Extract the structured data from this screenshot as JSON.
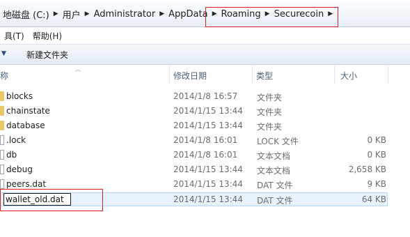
{
  "breadcrumb": [
    "地磁盘 (C:)",
    "用户",
    "Administrator",
    "AppData",
    "Roaming",
    "Securecoin"
  ],
  "menu": [
    "具(T)",
    "帮助(H)"
  ],
  "toolbar": {
    "new_folder": "新建文件夹"
  },
  "columns": {
    "name": "称",
    "date": "修改日期",
    "type": "类型",
    "size": "大小"
  },
  "files": [
    {
      "name": "blocks",
      "date": "2014/1/8 16:57",
      "type": "文件夹",
      "size": "",
      "kind": "folder"
    },
    {
      "name": "chainstate",
      "date": "2014/1/15 13:44",
      "type": "文件夹",
      "size": "",
      "kind": "folder"
    },
    {
      "name": "database",
      "date": "2014/1/15 13:44",
      "type": "文件夹",
      "size": "",
      "kind": "folder"
    },
    {
      "name": ".lock",
      "date": "2014/1/8 16:01",
      "type": "LOCK 文件",
      "size": "0 KB",
      "kind": "file"
    },
    {
      "name": "db",
      "date": "2014/1/8 16:01",
      "type": "文本文档",
      "size": "0 KB",
      "kind": "file"
    },
    {
      "name": "debug",
      "date": "2014/1/15 13:44",
      "type": "文本文档",
      "size": "2,658 KB",
      "kind": "file"
    },
    {
      "name": "peers.dat",
      "date": "2014/1/15 13:44",
      "type": "DAT 文件",
      "size": "9 KB",
      "kind": "file"
    },
    {
      "name": "wallet_old.dat",
      "date": "2014/1/15 13:44",
      "type": "DAT 文件",
      "size": "64 KB",
      "kind": "file"
    }
  ],
  "colors": {
    "highlight": "#e02020",
    "selection": "#e8f2fd",
    "folder": "#e9c766"
  }
}
